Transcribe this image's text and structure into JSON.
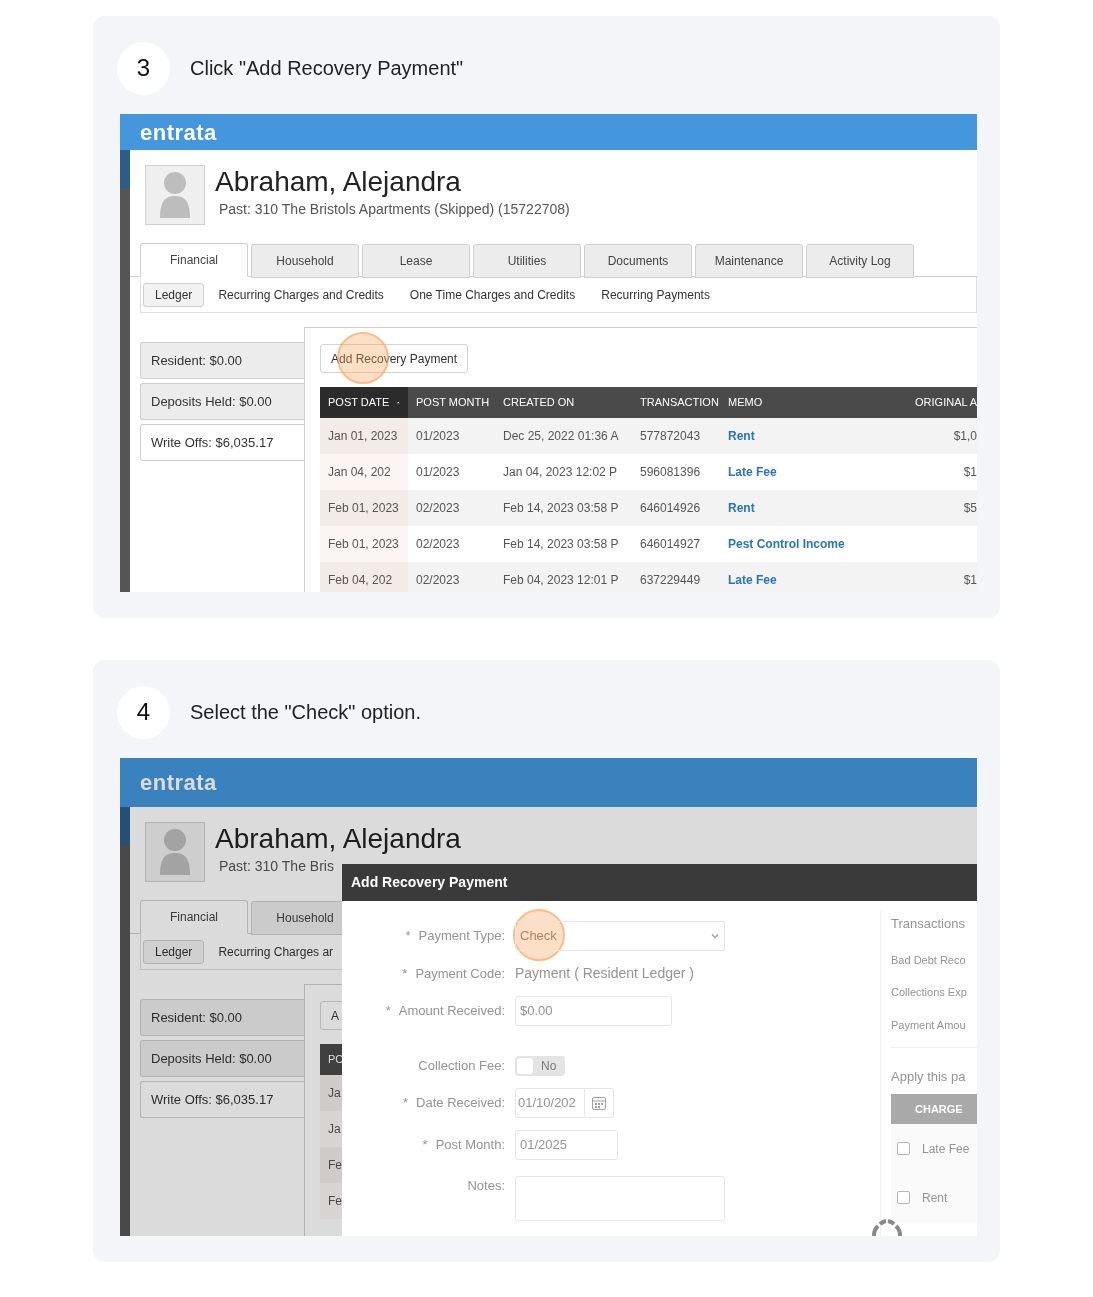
{
  "steps": [
    {
      "number": "3",
      "instruction": "Click \"Add Recovery Payment\"",
      "screen": {
        "logo": "entrata",
        "resident_name": "Abraham, Alejandra",
        "resident_subtitle": "Past: 310 The Bristols Apartments (Skipped) (15722708)",
        "tabs": [
          {
            "label": "Financial",
            "selected": true
          },
          {
            "label": "Household",
            "selected": false
          },
          {
            "label": "Lease",
            "selected": false
          },
          {
            "label": "Utilities",
            "selected": false
          },
          {
            "label": "Documents",
            "selected": false
          },
          {
            "label": "Maintenance",
            "selected": false
          },
          {
            "label": "Activity Log",
            "selected": false
          }
        ],
        "subtabs": [
          {
            "label": "Ledger",
            "selected": true
          },
          {
            "label": "Recurring Charges and Credits",
            "selected": false
          },
          {
            "label": "One Time Charges and Credits",
            "selected": false
          },
          {
            "label": "Recurring Payments",
            "selected": false
          }
        ],
        "balances": [
          {
            "label": "Resident: $0.00",
            "selected": false
          },
          {
            "label": "Deposits Held: $0.00",
            "selected": false
          },
          {
            "label": "Write Offs: $6,035.17",
            "selected": true
          }
        ],
        "action_button": {
          "label": "Add Recovery Payment",
          "highlighted": true
        },
        "table": {
          "columns": [
            {
              "label": "POST DATE",
              "sorted": true
            },
            {
              "label": "POST MONTH",
              "sorted": false
            },
            {
              "label": "CREATED ON",
              "sorted": false
            },
            {
              "label": "TRANSACTION",
              "sorted": false
            },
            {
              "label": "MEMO",
              "sorted": false
            },
            {
              "label": "ORIGINAL A",
              "sorted": false
            }
          ],
          "rows": [
            {
              "cells": [
                "Jan 01, 2023",
                "01/2023",
                "Dec 25, 2022 01:36 A",
                "577872043",
                "Rent",
                "$1,0"
              ]
            },
            {
              "cells": [
                "Jan 04, 202",
                "01/2023",
                "Jan 04, 2023 12:02 P",
                "596081396",
                "Late Fee",
                "$1"
              ]
            },
            {
              "cells": [
                "Feb 01, 2023",
                "02/2023",
                "Feb 14, 2023 03:58 P",
                "646014926",
                "Rent",
                "$5"
              ]
            },
            {
              "cells": [
                "Feb 01, 2023",
                "02/2023",
                "Feb 14, 2023 03:58 P",
                "646014927",
                "Pest Control Income"
              ]
            },
            {
              "cells": [
                "Feb 04, 202",
                "02/2023",
                "Feb 04, 2023 12:01 P",
                "637229449",
                "Late Fee",
                "$1"
              ]
            }
          ]
        }
      }
    },
    {
      "number": "4",
      "instruction": "Select the \"Check\" option.",
      "screen": {
        "logo": "entrata",
        "resident_name": "Abraham, Alejandra",
        "resident_subtitle": "Past: 310 The Bris",
        "tabs": [
          {
            "label": "Financial",
            "selected": true
          },
          {
            "label": "Household",
            "selected": false
          }
        ],
        "subtabs": [
          {
            "label": "Ledger",
            "selected": true
          },
          {
            "label": "Recurring Charges ar",
            "selected": false
          }
        ],
        "balances": [
          {
            "label": "Resident: $0.00",
            "selected": false
          },
          {
            "label": "Deposits Held: $0.00",
            "selected": false
          },
          {
            "label": "Write Offs: $6,035.17",
            "selected": true
          }
        ],
        "action_button": {
          "label": "A",
          "highlighted": false
        },
        "table": {
          "columns": [
            {
              "label": "PC",
              "sorted": false
            }
          ],
          "rows": [
            {
              "cells": [
                "Ja"
              ]
            },
            {
              "cells": [
                "Ja"
              ]
            },
            {
              "cells": [
                "Fe"
              ]
            },
            {
              "cells": [
                "Fe"
              ]
            }
          ]
        },
        "modal": {
          "title": "Add Recovery Payment",
          "fields": [
            {
              "kind": "select",
              "mark": "*",
              "label": "Payment Type:",
              "value": "Check",
              "highlighted": true
            },
            {
              "kind": "text",
              "mark": "*",
              "label": "Payment Code:",
              "value": "Payment ( Resident Ledger )"
            },
            {
              "kind": "input",
              "mark": "*",
              "label": "Amount Received:",
              "value": "$0.00"
            },
            {
              "kind": "toggle",
              "label": "Collection Fee:",
              "on": false,
              "state_label": "No"
            },
            {
              "kind": "date",
              "mark": "*",
              "label": "Date Received:",
              "value": "01/10/202"
            },
            {
              "kind": "month",
              "mark": "*",
              "label": "Post Month:",
              "value": "01/2025"
            },
            {
              "kind": "textarea",
              "label": "Notes:"
            }
          ],
          "side": {
            "title": "Transactions",
            "lines": [
              "Bad Debt Reco",
              "Collections Exp",
              "Payment Amou"
            ],
            "apply_text": "Apply this pa",
            "column": "CHARGE",
            "items": [
              {
                "label": "Late Fee",
                "checked": false
              },
              {
                "label": "Rent",
                "checked": false
              }
            ]
          }
        }
      }
    }
  ]
}
